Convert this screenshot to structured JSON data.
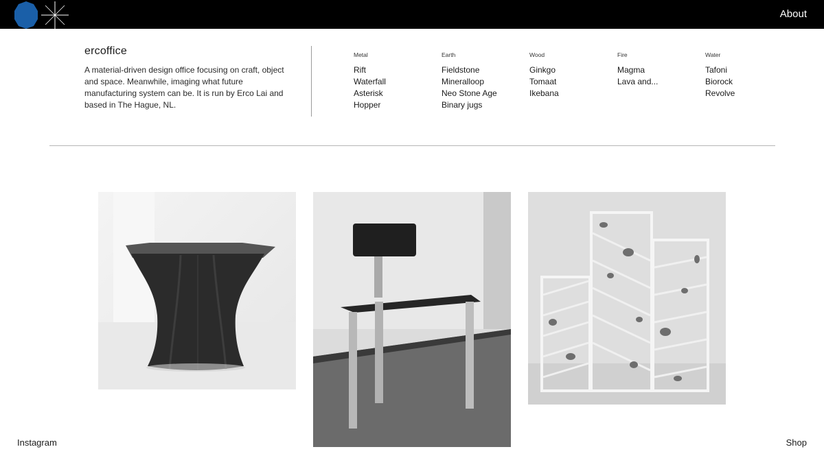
{
  "header": {
    "about_label": "About"
  },
  "intro": {
    "title": "ercoffice",
    "description": "A material-driven design office focusing on craft, object and space. Meanwhile, imaging what future manufacturing system can be. It is run by Erco Lai and based in The Hague, NL."
  },
  "categories": [
    {
      "name": "Metal",
      "items": [
        "Rift",
        "Waterfall",
        "Asterisk",
        "Hopper"
      ]
    },
    {
      "name": "Earth",
      "items": [
        "Fieldstone",
        "Mineralloop",
        "Neo Stone Age",
        "Binary jugs"
      ]
    },
    {
      "name": "Wood",
      "items": [
        "Ginkgo",
        "Tomaat",
        "Ikebana"
      ]
    },
    {
      "name": "Fire",
      "items": [
        "Magma",
        "Lava and..."
      ]
    },
    {
      "name": "Water",
      "items": [
        "Tafoni",
        "Biorock",
        "Revolve"
      ]
    }
  ],
  "footer": {
    "instagram_label": "Instagram",
    "shop_label": "Shop"
  },
  "colors": {
    "topbar": "#000000",
    "logo_blue": "#1a5fa8",
    "background": "#ffffff"
  }
}
